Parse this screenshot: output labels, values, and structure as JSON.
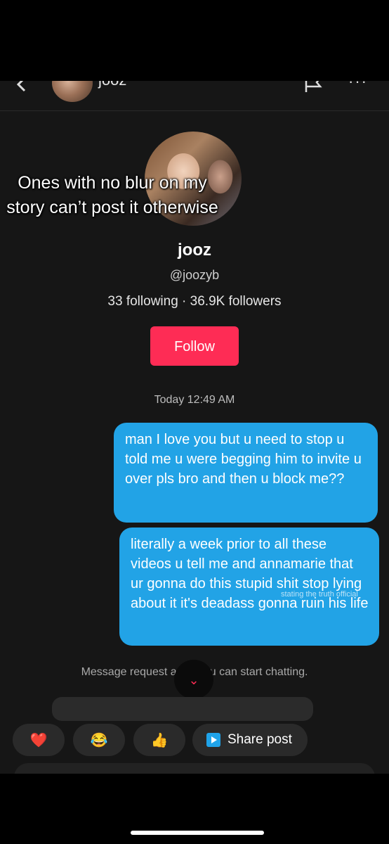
{
  "header": {
    "name": "jooz"
  },
  "profile": {
    "overlay_text": "Ones with no blur on my story can’t post it otherwise",
    "name": "jooz",
    "handle": "@joozyb",
    "stats": "33 following · 36.9K followers",
    "follow_label": "Follow"
  },
  "chat": {
    "timestamp": "Today 12:49 AM",
    "messages": [
      {
        "text": "man I love you but u need to stop u told me u were begging him to invite u over pls bro and then u block me??"
      },
      {
        "text": "literally a week prior to all these videos u tell me and annamarie that ur gonna do this stupid shit stop lying about it it's deadass gonna ruin his life"
      }
    ],
    "watermark": "stating the truth official",
    "system_message": "Message request acce        You can start chatting.",
    "scroll_down_glyph": "⌄"
  },
  "reactions": {
    "heart": "❤️",
    "laugh": "😂",
    "thumbs_up": "👍",
    "share_label": "Share post"
  },
  "colors": {
    "accent": "#fe2c55",
    "bubble": "#22a3e6",
    "background": "#161616"
  }
}
